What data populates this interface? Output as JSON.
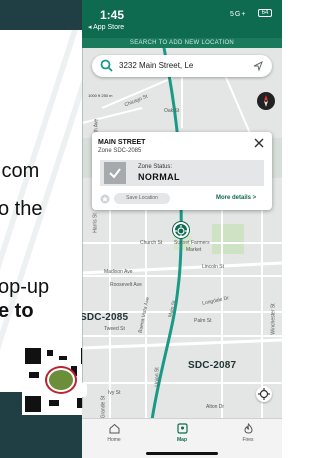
{
  "poster": {
    "line1": ".com",
    "line2": "o the",
    "line3": "op-up",
    "line4": "e to"
  },
  "statusbar": {
    "time": "1:45",
    "back_label": "◂ App Store",
    "signal": "5G+",
    "battery": "64"
  },
  "banner": {
    "text": "SEARCH TO ADD NEW LOCATION"
  },
  "search": {
    "address": "3232 Main Street, Le"
  },
  "map": {
    "scale": "1000 ft  250 m",
    "streets": {
      "chicago": "Chicago St",
      "oak": "Oak St",
      "harris": "Harris St",
      "church": "Church St",
      "sunset": "Sunset Farmers",
      "market": "Market",
      "lincoln": "Lincoln St",
      "madison": "Madison Ave",
      "roosevelt": "Roosevelt Ave",
      "longdale": "Longdale Dr",
      "tweed": "Tweed St",
      "buena": "Buena Vista Ave",
      "palm": "Palm St",
      "main": "Main St",
      "ivy": "Ivy St",
      "union": "Union St",
      "alton": "Alton Dr",
      "grande": "Grande St",
      "winchester": "Winchester St",
      "ave5": "5th Ave"
    },
    "zones": {
      "left": "SDC-2085",
      "right": "SDC-2087"
    }
  },
  "card": {
    "title": "MAIN STREET",
    "subtitle": "Zone SDC-2085",
    "status_label": "Zone Status:",
    "status_value": "NORMAL",
    "save_label": "Save Location",
    "more_label": "More details >"
  },
  "nav": {
    "items": [
      {
        "label": "Home",
        "icon": "home-icon"
      },
      {
        "label": "Map",
        "icon": "map-icon"
      },
      {
        "label": "Fires",
        "icon": "fire-icon"
      }
    ]
  },
  "colors": {
    "brand_green": "#0f6b4f",
    "route_teal": "#1a9a86",
    "poster_dark": "#1f3f45"
  }
}
